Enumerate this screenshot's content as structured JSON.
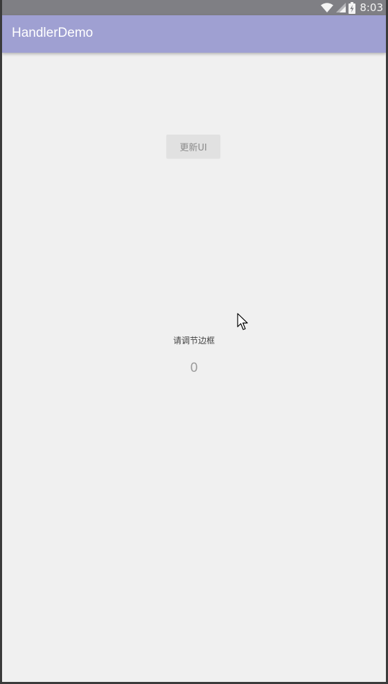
{
  "status_bar": {
    "time": "8:03",
    "icons": [
      "wifi-icon",
      "cellular-signal-icon",
      "battery-charging-icon"
    ]
  },
  "app_bar": {
    "title": "HandlerDemo",
    "color": "#9fa0d2"
  },
  "main": {
    "update_button_label": "更新UI",
    "prompt_text": "请调节边框",
    "value_text": "0"
  },
  "colors": {
    "background": "#f0f0f0",
    "status_bar": "#7f7f84"
  }
}
